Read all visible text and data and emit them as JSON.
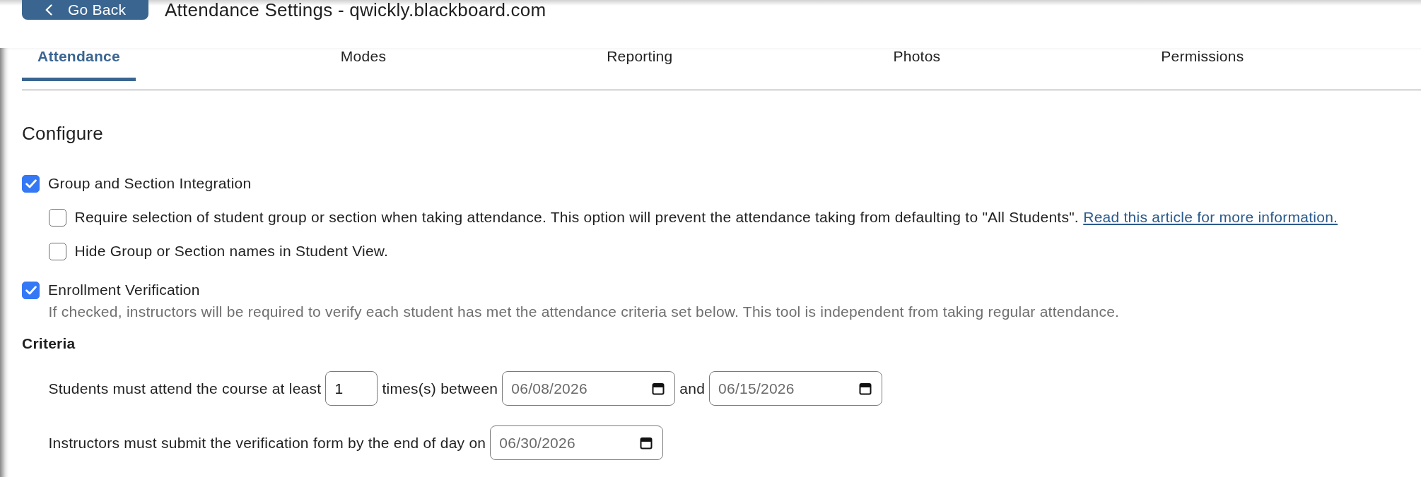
{
  "header": {
    "back_button": "Go Back",
    "title": "Attendance Settings - qwickly.blackboard.com"
  },
  "tabs": [
    {
      "label": "Attendance",
      "selected": true
    },
    {
      "label": "Modes",
      "selected": false
    },
    {
      "label": "Reporting",
      "selected": false
    },
    {
      "label": "Photos",
      "selected": false
    },
    {
      "label": "Permissions",
      "selected": false
    }
  ],
  "configure": {
    "title": "Configure",
    "options": [
      {
        "label": "Group and Section Integration",
        "checked": true,
        "children": [
          {
            "label": "Require selection of student group or section when taking attendance. This option will prevent the attendance taking from defaulting to \"All Students\".",
            "link": "Read this article for more information.",
            "checked": false
          },
          {
            "label": "Hide Group or Section names in Student View.",
            "checked": false
          }
        ]
      },
      {
        "label": "Enrollment Verification",
        "checked": true,
        "help": "If checked, instructors will be required to verify each student has met the attendance criteria set below. This tool is independent from taking regular attendance."
      }
    ]
  },
  "criteria": {
    "title": "Criteria",
    "attendance_rule": {
      "lead": "Students must attend the course at least",
      "times": "1",
      "between_label": "times(s) between",
      "start_date": "06/08/2026",
      "and_label": "and",
      "end_date": "06/15/2026"
    },
    "deadline_rule": {
      "lead": "Instructors must submit the verification form by the end of day on",
      "date": "06/30/2026"
    }
  }
}
